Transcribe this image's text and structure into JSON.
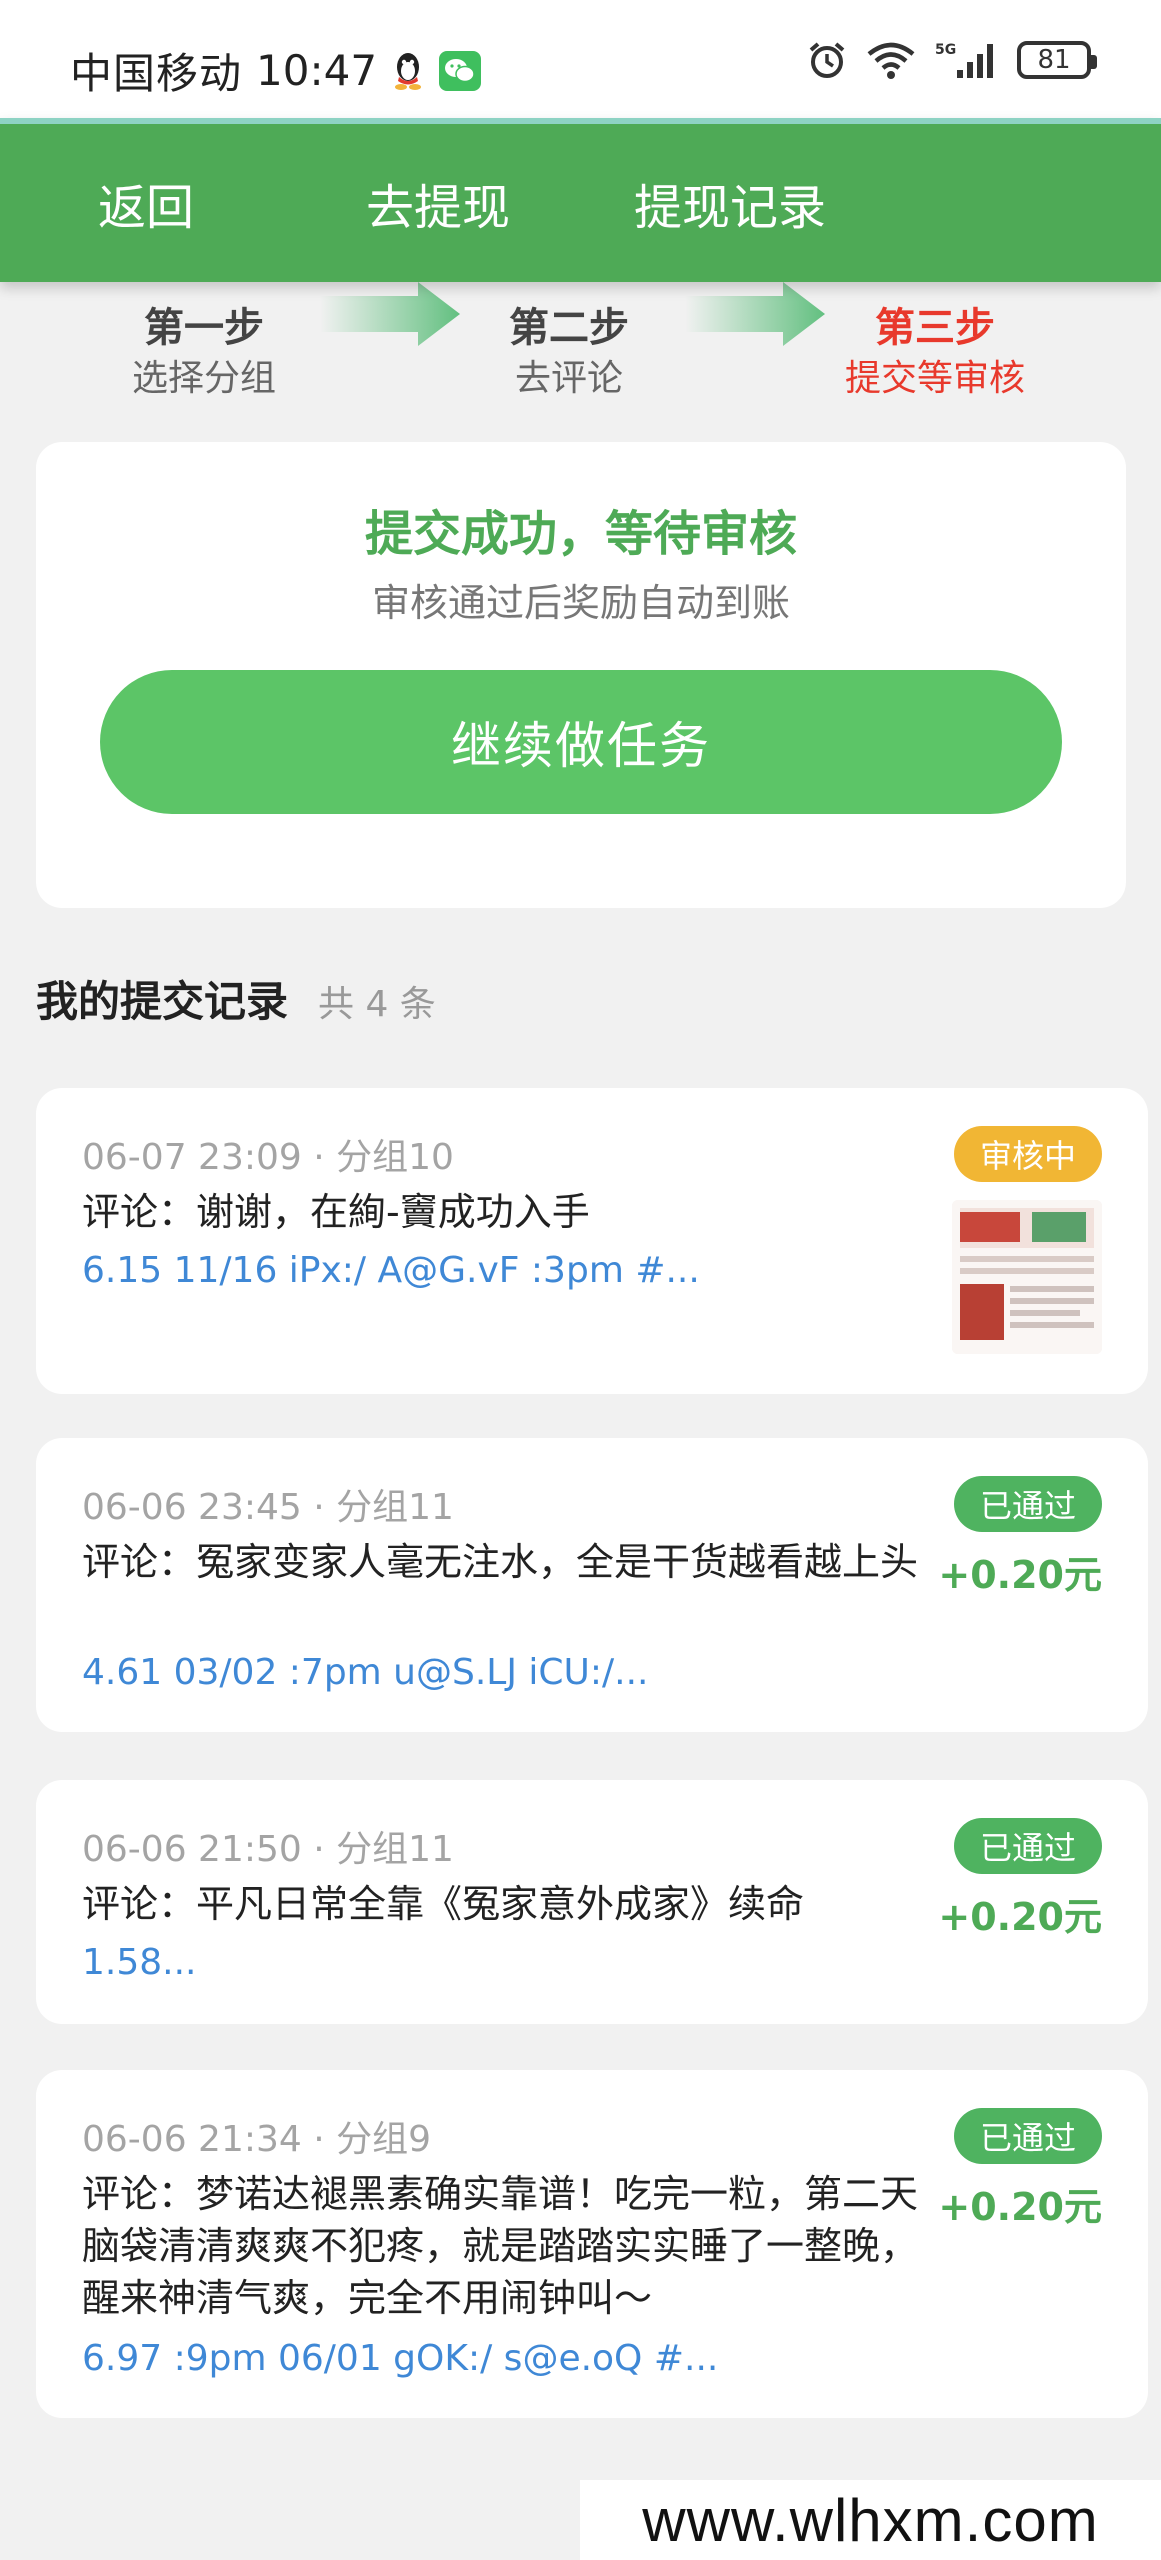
{
  "status_bar": {
    "carrier": "中国移动",
    "time": "10:47",
    "battery": "81",
    "network": "5G"
  },
  "nav": {
    "back": "返回",
    "withdraw": "去提现",
    "withdraw_records": "提现记录"
  },
  "steps": [
    {
      "title": "第一步",
      "sub": "选择分组",
      "active": false
    },
    {
      "title": "第二步",
      "sub": "去评论",
      "active": false
    },
    {
      "title": "第三步",
      "sub": "提交等审核",
      "active": true
    }
  ],
  "success": {
    "title": "提交成功，等待审核",
    "subtitle": "审核通过后奖励自动到账",
    "button": "继续做任务"
  },
  "records": {
    "title": "我的提交记录",
    "count": "共 4 条",
    "items": [
      {
        "meta": "06-07 23:09 · 分组10",
        "comment": "评论：谢谢，在絢-竇成功入手",
        "link": "6.15 11/16 iPx:/ A@G.vF :3pm #...",
        "status": "审核中",
        "reward": ""
      },
      {
        "meta": "06-06 23:45 · 分组11",
        "comment": "评论：冤家变家人毫无注水，全是干货越看越上头",
        "link": "4.61 03/02 :7pm u@S.LJ iCU:/...",
        "status": "已通过",
        "reward": "+0.20元"
      },
      {
        "meta": "06-06 21:50 · 分组11",
        "comment": "评论：平凡日常全靠《冤家意外成家》续命",
        "link": "1.58...",
        "status": "已通过",
        "reward": "+0.20元"
      },
      {
        "meta": "06-06 21:34 · 分组9",
        "comment": "评论：梦诺达褪黑素确实靠谱！吃完一粒，第二天脑袋清清爽爽不犯疼，就是踏踏实实睡了一整晚，醒来神清气爽，完全不用闹钟叫～",
        "link": "6.97 :9pm 06/01 gOK:/ s@e.oQ #...",
        "status": "已通过",
        "reward": "+0.20元"
      }
    ]
  },
  "watermark": "www.wlhxm.com",
  "colors": {
    "primary_green": "#4eaa56",
    "button_green": "#5cc567",
    "pending_orange": "#f1b634",
    "active_red": "#e8392c",
    "link_blue": "#3f88d6"
  }
}
